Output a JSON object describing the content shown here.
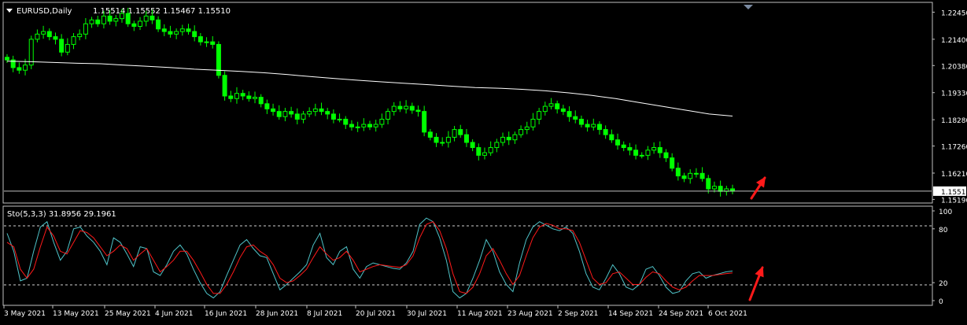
{
  "header": {
    "symbol_label": "EURUSD,Daily",
    "ohlc_label": "1.15514 1.15552 1.15467 1.15510"
  },
  "indicator": {
    "label": "Sto(5,3,3) 31.8956 29.1961"
  },
  "colors": {
    "background": "#000000",
    "frame": "#c0c0c0",
    "candle": "#00ff00",
    "moving_average": "#ffffff",
    "price_line": "#c0c0c0",
    "current_price_box": "#ffffff",
    "stoch_main": "#4fc3c8",
    "stoch_signal": "#ff1a1a",
    "arrow": "#ff1a1a",
    "axis_text": "#ffffff"
  },
  "chart_data": [
    {
      "type": "candlestick",
      "symbol": "EURUSD",
      "timeframe": "Daily",
      "last_ohlc": {
        "open": 1.15514,
        "high": 1.15552,
        "low": 1.15467,
        "close": 1.1551
      },
      "current_price": "1.15510",
      "y_ticks": [
        "1.22450",
        "1.21400",
        "1.20380",
        "1.19330",
        "1.18280",
        "1.17260",
        "1.16210",
        "1.15190"
      ],
      "ylim": [
        1.1508,
        1.228
      ],
      "x_ticks": [
        "3 May 2021",
        "13 May 2021",
        "25 May 2021",
        "4 Jun 2021",
        "16 Jun 2021",
        "28 Jun 2021",
        "8 Jul 2021",
        "20 Jul 2021",
        "30 Jul 2021",
        "11 Aug 2021",
        "23 Aug 2021",
        "2 Sep 2021",
        "14 Sep 2021",
        "24 Sep 2021",
        "6 Oct 2021"
      ],
      "closes": [
        1.206,
        1.203,
        1.202,
        1.204,
        1.214,
        1.216,
        1.217,
        1.215,
        1.214,
        1.209,
        1.212,
        1.215,
        1.216,
        1.22,
        1.2215,
        1.22,
        1.223,
        1.221,
        1.222,
        1.224,
        1.22,
        1.219,
        1.221,
        1.223,
        1.2215,
        1.218,
        1.217,
        1.216,
        1.217,
        1.218,
        1.217,
        1.215,
        1.213,
        1.213,
        1.212,
        1.2,
        1.192,
        1.191,
        1.193,
        1.192,
        1.191,
        1.1915,
        1.189,
        1.187,
        1.186,
        1.184,
        1.186,
        1.185,
        1.183,
        1.185,
        1.186,
        1.187,
        1.186,
        1.185,
        1.183,
        1.183,
        1.181,
        1.18,
        1.18,
        1.181,
        1.18,
        1.181,
        1.183,
        1.186,
        1.188,
        1.187,
        1.188,
        1.1865,
        1.186,
        1.178,
        1.176,
        1.174,
        1.174,
        1.176,
        1.179,
        1.177,
        1.174,
        1.172,
        1.169,
        1.17,
        1.172,
        1.174,
        1.176,
        1.175,
        1.177,
        1.179,
        1.18,
        1.183,
        1.186,
        1.188,
        1.189,
        1.187,
        1.186,
        1.184,
        1.183,
        1.181,
        1.18,
        1.181,
        1.179,
        1.177,
        1.175,
        1.173,
        1.172,
        1.171,
        1.169,
        1.169,
        1.171,
        1.172,
        1.17,
        1.168,
        1.164,
        1.161,
        1.16,
        1.162,
        1.162,
        1.16,
        1.156,
        1.157,
        1.155,
        1.156,
        1.1551
      ],
      "moving_average": {
        "closes_first": 1.2055,
        "closes_last": 1.1842,
        "values": [
          1.2055,
          1.2053,
          1.205,
          1.2047,
          1.2045,
          1.204,
          1.2035,
          1.203,
          1.2024,
          1.202,
          1.2015,
          1.201,
          1.2003,
          1.1995,
          1.1988,
          1.1981,
          1.1975,
          1.1969,
          1.1964,
          1.1958,
          1.1953,
          1.195,
          1.1946,
          1.194,
          1.1932,
          1.1922,
          1.191,
          1.1895,
          1.188,
          1.1865,
          1.185,
          1.1842
        ]
      },
      "arrow": {
        "direction": "up"
      }
    },
    {
      "type": "line",
      "indicator": "Stochastic",
      "params": "5,3,3",
      "ylim": [
        0,
        100
      ],
      "y_ticks": [
        "100",
        "80",
        "20",
        "0"
      ],
      "levels": [
        80,
        20
      ],
      "series": [
        {
          "values": [
            75,
            55,
            22,
            25,
            55,
            82,
            88,
            65,
            45,
            55,
            80,
            82,
            72,
            65,
            55,
            40,
            70,
            65,
            52,
            38,
            60,
            58,
            32,
            28,
            40,
            55,
            62,
            52,
            35,
            20,
            8,
            3,
            10,
            28,
            45,
            62,
            68,
            58,
            50,
            48,
            30,
            12,
            18,
            25,
            32,
            40,
            62,
            75,
            48,
            40,
            55,
            60,
            35,
            25,
            38,
            42,
            40,
            38,
            36,
            35,
            42,
            55,
            85,
            92,
            88,
            70,
            45,
            10,
            3,
            8,
            25,
            45,
            68,
            55,
            32,
            18,
            10,
            42,
            68,
            82,
            88,
            84,
            80,
            78,
            82,
            75,
            55,
            30,
            15,
            12,
            25,
            40,
            30,
            15,
            12,
            18,
            35,
            38,
            28,
            15,
            8,
            10,
            22,
            30,
            32,
            25,
            28,
            30,
            32,
            33
          ]
        },
        {
          "values": [
            65,
            60,
            35,
            25,
            35,
            60,
            82,
            72,
            55,
            52,
            65,
            78,
            76,
            70,
            60,
            50,
            55,
            62,
            58,
            45,
            52,
            58,
            45,
            32,
            38,
            45,
            55,
            55,
            45,
            32,
            18,
            8,
            8,
            18,
            32,
            48,
            60,
            62,
            55,
            50,
            40,
            25,
            20,
            22,
            28,
            35,
            48,
            60,
            52,
            45,
            48,
            55,
            45,
            32,
            35,
            38,
            40,
            39,
            38,
            37,
            40,
            50,
            70,
            85,
            88,
            78,
            58,
            30,
            10,
            8,
            15,
            30,
            50,
            58,
            45,
            30,
            18,
            28,
            50,
            70,
            82,
            86,
            84,
            80,
            80,
            78,
            65,
            45,
            25,
            18,
            20,
            30,
            32,
            25,
            18,
            18,
            26,
            32,
            30,
            22,
            15,
            12,
            15,
            22,
            28,
            28,
            28,
            29,
            30,
            31
          ]
        }
      ],
      "arrow": {
        "direction": "up"
      }
    }
  ]
}
